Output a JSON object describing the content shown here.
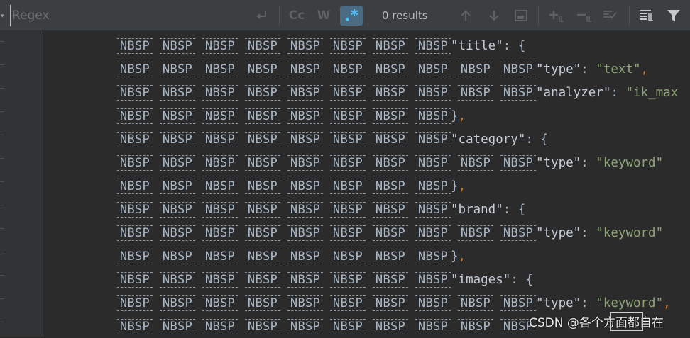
{
  "search": {
    "placeholder": "Regex",
    "value": "",
    "results_label": "0 results",
    "match_case_label": "Cc",
    "words_label": "W",
    "regex_label": ".*"
  },
  "icons": {
    "newline": "newline-icon",
    "prev": "arrow-up-icon",
    "next": "arrow-down-icon",
    "select_all": "select-all-icon",
    "add_selection": "add-selection-icon",
    "remove_selection": "remove-selection-icon",
    "select_all_occurrences": "select-occurrences-icon",
    "filter_settings": "filter-settings-icon",
    "filter": "filter-icon"
  },
  "colors": {
    "background": "#2b2b2b",
    "toolbar": "#3c3f41",
    "regex_active": "#4a6b82",
    "key": "#c4ccd6",
    "string": "#8da377",
    "comma": "#cc7832"
  },
  "nbsp_label": "NBSP",
  "code_lines": [
    {
      "nbsp": 8,
      "text": "\"title\": {",
      "parts": [
        {
          "t": "\"title\"",
          "c": "key"
        },
        {
          "t": ": {",
          "c": "punc"
        }
      ]
    },
    {
      "nbsp": 10,
      "text": "\"type\": \"text\",",
      "parts": [
        {
          "t": "\"type\"",
          "c": "key"
        },
        {
          "t": ": ",
          "c": "punc"
        },
        {
          "t": "\"text\"",
          "c": "str"
        },
        {
          "t": ",",
          "c": "comma"
        }
      ]
    },
    {
      "nbsp": 10,
      "text": "\"analyzer\": \"ik_max",
      "parts": [
        {
          "t": "\"analyzer\"",
          "c": "key"
        },
        {
          "t": ": ",
          "c": "punc"
        },
        {
          "t": "\"ik_max",
          "c": "str"
        }
      ]
    },
    {
      "nbsp": 8,
      "text": "},",
      "parts": [
        {
          "t": "}",
          "c": "punc"
        },
        {
          "t": ",",
          "c": "comma"
        }
      ]
    },
    {
      "nbsp": 8,
      "text": "\"category\": {",
      "parts": [
        {
          "t": "\"category\"",
          "c": "key"
        },
        {
          "t": ": {",
          "c": "punc"
        }
      ]
    },
    {
      "nbsp": 10,
      "text": "\"type\": \"keyword\"",
      "parts": [
        {
          "t": "\"type\"",
          "c": "key"
        },
        {
          "t": ": ",
          "c": "punc"
        },
        {
          "t": "\"keyword\"",
          "c": "str"
        }
      ]
    },
    {
      "nbsp": 8,
      "text": "},",
      "parts": [
        {
          "t": "}",
          "c": "punc"
        },
        {
          "t": ",",
          "c": "comma"
        }
      ]
    },
    {
      "nbsp": 8,
      "text": "\"brand\": {",
      "parts": [
        {
          "t": "\"brand\"",
          "c": "key"
        },
        {
          "t": ": {",
          "c": "punc"
        }
      ]
    },
    {
      "nbsp": 10,
      "text": "\"type\": \"keyword\"",
      "parts": [
        {
          "t": "\"type\"",
          "c": "key"
        },
        {
          "t": ": ",
          "c": "punc"
        },
        {
          "t": "\"keyword\"",
          "c": "str"
        }
      ]
    },
    {
      "nbsp": 8,
      "text": "},",
      "parts": [
        {
          "t": "}",
          "c": "punc"
        },
        {
          "t": ",",
          "c": "comma"
        }
      ]
    },
    {
      "nbsp": 8,
      "text": "\"images\": {",
      "parts": [
        {
          "t": "\"images\"",
          "c": "key"
        },
        {
          "t": ": {",
          "c": "punc"
        }
      ]
    },
    {
      "nbsp": 10,
      "text": "\"type\": \"keyword\",",
      "parts": [
        {
          "t": "\"type\"",
          "c": "key"
        },
        {
          "t": ": ",
          "c": "punc"
        },
        {
          "t": "\"keyword\"",
          "c": "str"
        },
        {
          "t": ",",
          "c": "comma"
        }
      ]
    },
    {
      "nbsp": 10,
      "text": "",
      "parts": []
    }
  ],
  "watermark": "CSDN @各个方面都自在"
}
